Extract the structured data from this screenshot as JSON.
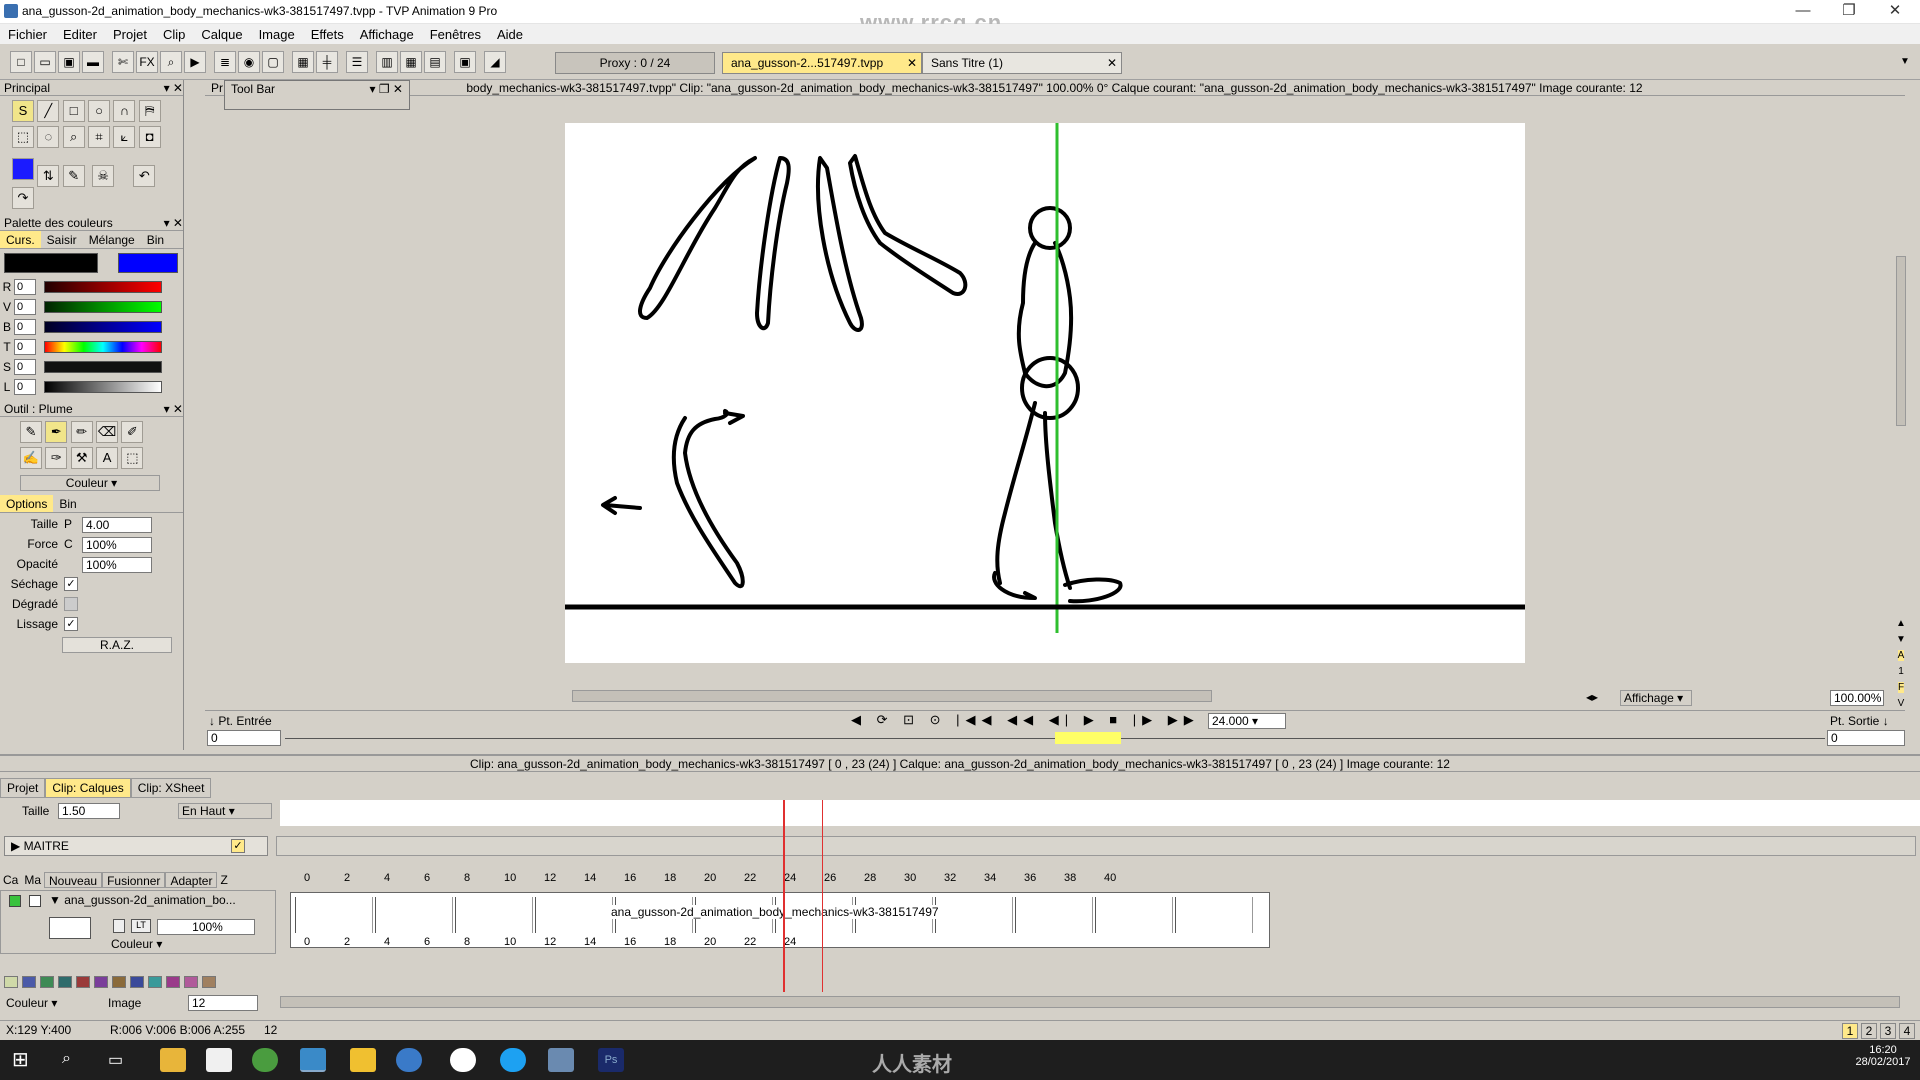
{
  "window": {
    "title": "ana_gusson-2d_animation_body_mechanics-wk3-381517497.tvpp - TVP Animation 9 Pro",
    "watermark": "www.rrcg.cn"
  },
  "menu": [
    "Fichier",
    "Editer",
    "Projet",
    "Clip",
    "Calque",
    "Image",
    "Effets",
    "Affichage",
    "Fenêtres",
    "Aide"
  ],
  "toolbar": {
    "proxy": "Proxy : 0 / 24",
    "doc_tab_active": "ana_gusson-2...517497.tvpp",
    "doc_tab_2": "Sans Titre (1)"
  },
  "left_panels": {
    "principal": "Principal",
    "palette": "Palette des couleurs",
    "palette_tabs": [
      "Curs.",
      "Saisir",
      "Mélange",
      "Bin"
    ],
    "rgb": [
      {
        "l": "R",
        "v": "0"
      },
      {
        "l": "V",
        "v": "0"
      },
      {
        "l": "B",
        "v": "0"
      },
      {
        "l": "T",
        "v": "0"
      },
      {
        "l": "S",
        "v": "0"
      },
      {
        "l": "L",
        "v": "0"
      }
    ],
    "tool": "Outil : Plume",
    "couleur": "Couleur",
    "options_tabs": [
      "Options",
      "Bin"
    ],
    "params": [
      {
        "label": "Taille",
        "pre": "P",
        "value": "4.00"
      },
      {
        "label": "Force",
        "pre": "C",
        "value": "100%"
      },
      {
        "label": "Opacité",
        "pre": "",
        "value": "100%"
      }
    ],
    "checks": [
      "Séchage",
      "Dégradé",
      "Lissage"
    ],
    "raz": "R.A.Z."
  },
  "view": {
    "toolbar_label": "Tool Bar",
    "status": "body_mechanics-wk3-381517497.tvpp\"  Clip: \"ana_gusson-2d_animation_body_mechanics-wk3-381517497\"  100.00%  0°  Calque courant: \"ana_gusson-2d_animation_body_mechanics-wk3-381517497\"  Image courante: 12",
    "pt_entree": "Pt. Entrée",
    "pt_sortie": "Pt. Sortie",
    "fps": "24.000",
    "affichage": "Affichage",
    "zoom": "100.00%",
    "in_val": "0",
    "out_val": "0"
  },
  "timeline": {
    "info": "Clip: ana_gusson-2d_animation_body_mechanics-wk3-381517497 [ 0 , 23  (24) ]        Calque: ana_gusson-2d_animation_body_mechanics-wk3-381517497 [ 0 , 23  (24) ]        Image courante: 12",
    "tabs": [
      "Projet",
      "Clip: Calques",
      "Clip: XSheet"
    ],
    "taille_label": "Taille",
    "taille": "1.50",
    "position": "En Haut",
    "maitre": "MAITRE",
    "col_heads": [
      "Ca",
      "Ma",
      "Nouveau",
      "Fusionner",
      "Adapter",
      "Z"
    ],
    "layer_name": "ana_gusson-2d_animation_bo...",
    "layer_opacity": "100%",
    "layer_mode": "Couleur",
    "clip_label": "ana_gusson-2d_animation_body_mechanics-wk3-381517497",
    "ticks": [
      "0",
      "2",
      "4",
      "6",
      "8",
      "10",
      "12",
      "14",
      "16",
      "18",
      "20",
      "22",
      "24",
      "26",
      "28",
      "30",
      "32",
      "34",
      "36",
      "38",
      "40"
    ],
    "bottom_ticks": [
      "0",
      "2",
      "4",
      "6",
      "8",
      "10",
      "12",
      "14",
      "16",
      "18",
      "20",
      "22",
      "24"
    ],
    "couleur": "Couleur",
    "image_label": "Image",
    "image_val": "12"
  },
  "statusbar": {
    "coords": "X:129 Y:400",
    "rgba": "R:006 V:006 B:006 A:255",
    "frame": "12",
    "pages": [
      "1",
      "2",
      "3",
      "4"
    ]
  },
  "taskbar": {
    "time": "16:20",
    "date": "28/02/2017",
    "brand": "人人素材"
  },
  "colors": {
    "accent": "#ffe98a",
    "guide": "#2fbf2f",
    "playhead": "#e03030"
  }
}
